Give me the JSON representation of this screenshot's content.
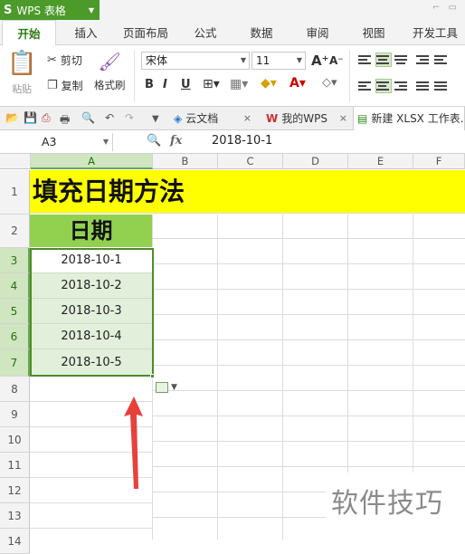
{
  "app": {
    "logo": "S",
    "title": "WPS 表格"
  },
  "tabs": [
    "开始",
    "插入",
    "页面布局",
    "公式",
    "数据",
    "审阅",
    "视图",
    "开发工具"
  ],
  "ribbon": {
    "paste": "粘贴",
    "cut": "剪切",
    "copy": "复制",
    "format_painter": "格式刷",
    "font_name": "宋体",
    "font_size": "11",
    "bold": "B",
    "italic": "I",
    "underline": "U"
  },
  "doc_tabs": {
    "cloud": "云文档",
    "mywps": "我的WPS",
    "current": "新建 XLSX 工作表."
  },
  "formula_bar": {
    "name_box": "A3",
    "fx": "fx",
    "value": "2018-10-1"
  },
  "columns": [
    "A",
    "B",
    "C",
    "D",
    "E",
    "F"
  ],
  "rows": [
    "1",
    "2",
    "3",
    "4",
    "5",
    "6",
    "7",
    "8",
    "9",
    "10",
    "11",
    "12",
    "13",
    "14"
  ],
  "cells": {
    "title": "填充日期方法",
    "header": "日期",
    "dates": [
      "2018-10-1",
      "2018-10-2",
      "2018-10-3",
      "2018-10-4",
      "2018-10-5"
    ]
  },
  "watermark": "软件技巧",
  "colors": {
    "brand": "#4c9a2a",
    "title_fill": "#ffff00",
    "header_fill": "#92d050",
    "data_fill": "#e2efda",
    "arrow": "#e8413c"
  }
}
